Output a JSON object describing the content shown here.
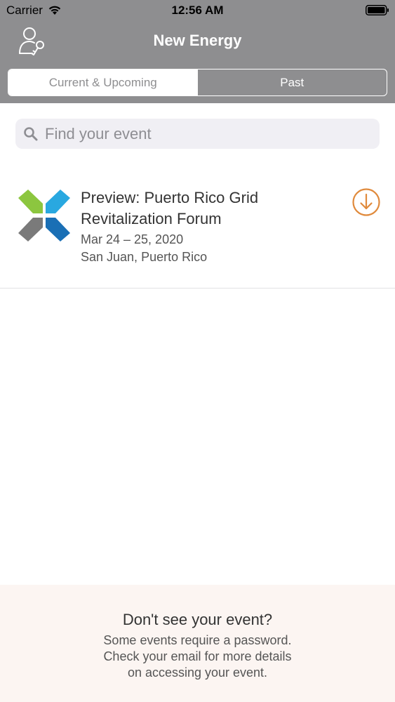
{
  "status_bar": {
    "carrier": "Carrier",
    "time": "12:56 AM"
  },
  "nav": {
    "title": "New Energy",
    "login_icon": "user-key-icon"
  },
  "tabs": [
    {
      "label": "Current & Upcoming",
      "selected": true
    },
    {
      "label": "Past",
      "selected": false
    }
  ],
  "search": {
    "placeholder": "Find your event",
    "value": ""
  },
  "events": [
    {
      "title": "Preview: Puerto Rico Grid Revitalization Forum",
      "dates": "Mar 24 – 25, 2020",
      "location": "San Juan, Puerto Rico",
      "action_icon": "download-icon"
    }
  ],
  "footer": {
    "title": "Don't see your event?",
    "lines": [
      "Some events require a password.",
      "Check your email for more details",
      "on accessing your event."
    ]
  },
  "colors": {
    "header_bg": "#8e8e90",
    "accent_orange": "#e08a3c",
    "logo_green": "#8cc63f",
    "logo_light_blue": "#29a8e0",
    "logo_gray": "#7a7a7a",
    "logo_dark_blue": "#1a6fb5",
    "footer_bg": "#fcf5f2"
  }
}
